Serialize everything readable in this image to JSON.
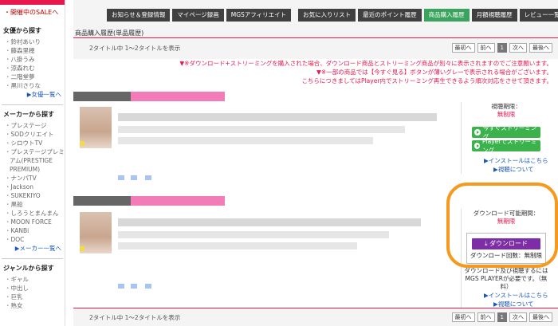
{
  "sidebar": {
    "sale_link": "・開催中のSALEへ",
    "sections": [
      {
        "heading": "女優から探す",
        "items": [
          "鈴村あいり",
          "藤森里穂",
          "八掛うみ",
          "涼森れむ",
          "二階堂夢",
          "黒川さりな"
        ],
        "more": "女優一覧へ"
      },
      {
        "heading": "メーカーから探す",
        "items": [
          "プレステージ",
          "SODクリエイト",
          "シロウトTV",
          "プレステージプレミアム(PRESTIGE PREMIUM)",
          "ナンパTV",
          "Jackson",
          "SUKEKIYO",
          "黒船",
          "しろうとまんまん",
          "MOON FORCE",
          "KANBi",
          "DOC"
        ],
        "more": "メーカー一覧へ"
      },
      {
        "heading": "ジャンルから探す",
        "items": [
          "ギャル",
          "中出し",
          "巨乳",
          "熟女"
        ]
      }
    ]
  },
  "tabs": [
    {
      "label": "お知らせ＆登録情報",
      "active": false
    },
    {
      "label": "マイページ録画",
      "active": false
    },
    {
      "label": "MGSアフィリエイト",
      "active": false
    },
    {
      "label": "お気に入りリスト",
      "active": false
    },
    {
      "label": "最近のポイント履歴",
      "active": false
    },
    {
      "label": "商品購入履歴",
      "active": true
    },
    {
      "label": "月額視聴履歴",
      "active": false
    },
    {
      "label": "レビュー一覧",
      "active": false
    }
  ],
  "page_title": "商品購入履歴(単品履歴)",
  "pager": {
    "count_text": "2タイトル中 1〜2タイトルを表示",
    "first": "最初へ",
    "prev": "前へ",
    "current": "1",
    "next": "次へ",
    "last": "最後へ"
  },
  "notice": {
    "line1": "▼※ダウンロード+ストリーミングを購入された場合、ダウンロード商品とストリーミング商品が別々に表示されますのでご注意願います。",
    "line2": "▼※一部の商品では【今すぐ見る】ボタンが薄いグレーで表示される場合がございます。",
    "line3": "こちらにつきましてはPlayer内でストリーミング再生できるよう順次対応をさせて頂きます。"
  },
  "product1": {
    "label": "視聴期限：",
    "value": "無制限",
    "btn_stream": "今すぐストリーミング",
    "btn_player": "Playerでストリーミング",
    "link_install": "インストールはこちら",
    "link_about": "視聴について"
  },
  "product2": {
    "label": "ダウンロード可能期間：",
    "value": "無期限",
    "btn_download": "ダウンロード",
    "dl_count": "ダウンロード回数：無制限",
    "note1": "ダウンロード及び視聴するには",
    "note2": "MGS PLAYERが必要です。（無料）",
    "link_install": "インストールはこちら",
    "link_about": "視聴について"
  },
  "colors": {
    "accent_pink": "#e8174d",
    "tab_dark": "#404040",
    "tab_active": "#3aa35e",
    "download_purple": "#7d2ea6",
    "stream_green": "#3bb24b",
    "highlight_orange": "#f59a1e"
  }
}
